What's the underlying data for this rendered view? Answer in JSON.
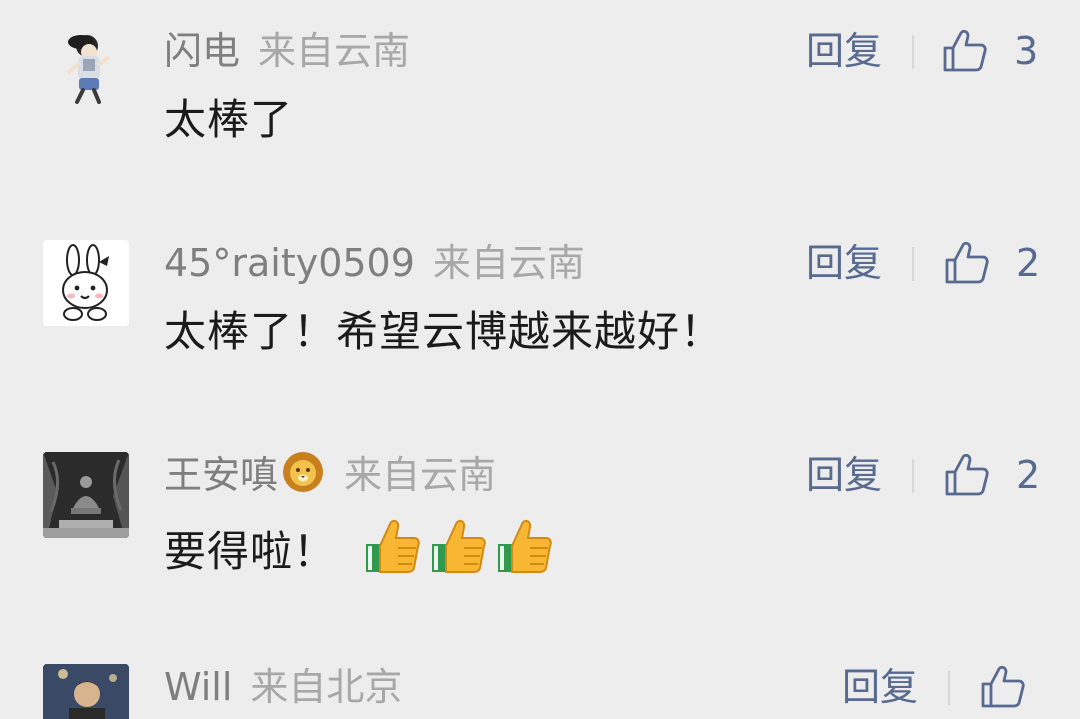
{
  "comments": [
    {
      "name": "闪电",
      "location": "来自云南",
      "text": "太棒了",
      "reply_label": "回复",
      "likes": "3",
      "avatar_icon": "cartoon-girl-avatar"
    },
    {
      "name": "45°raity0509",
      "location": "来自云南",
      "text": "太棒了！希望云博越来越好！",
      "reply_label": "回复",
      "likes": "2",
      "avatar_icon": "rabbit-avatar"
    },
    {
      "name": "王安嗔",
      "name_badge_icon": "lion-emoji-icon",
      "location": "来自云南",
      "text": "要得啦！",
      "emojis": [
        "thumbs-up-emoji-icon",
        "thumbs-up-emoji-icon",
        "thumbs-up-emoji-icon"
      ],
      "reply_label": "回复",
      "likes": "2",
      "avatar_icon": "buddha-forest-avatar"
    },
    {
      "name": "Will",
      "location": "来自北京",
      "reply_label": "回复",
      "avatar_icon": "person-photo-avatar"
    }
  ],
  "colors": {
    "background": "#ededed",
    "name": "#7f7f7f",
    "location": "#a8a8a8",
    "content": "#1b1b1b",
    "action": "#586a8f"
  }
}
